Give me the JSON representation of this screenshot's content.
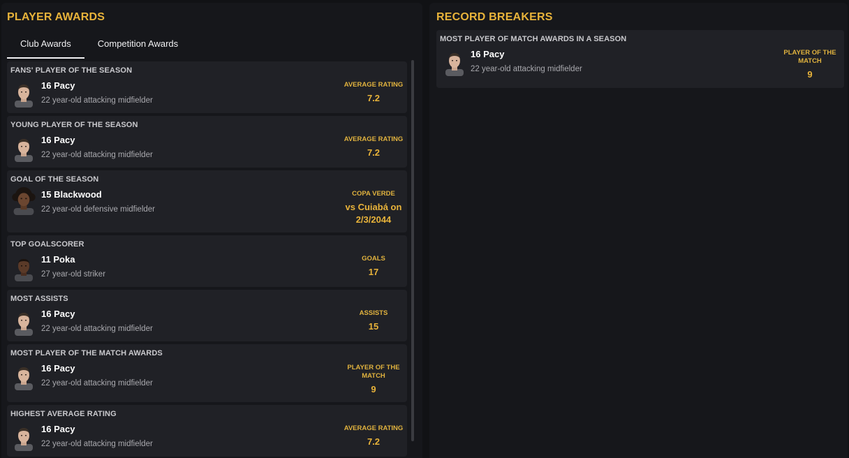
{
  "left_panel": {
    "title": "PLAYER AWARDS",
    "tabs": [
      {
        "label": "Club Awards",
        "active": true
      },
      {
        "label": "Competition Awards",
        "active": false
      }
    ],
    "awards": [
      {
        "title": "FANS' PLAYER OF THE SEASON",
        "player": "16 Pacy",
        "desc": "22 year-old attacking midfielder",
        "stat_label": "AVERAGE RATING",
        "stat_value": "7.2"
      },
      {
        "title": "YOUNG PLAYER OF THE SEASON",
        "player": "16 Pacy",
        "desc": "22 year-old attacking midfielder",
        "stat_label": "AVERAGE RATING",
        "stat_value": "7.2"
      },
      {
        "title": "GOAL OF THE SEASON",
        "player": "15 Blackwood",
        "desc": "22 year-old defensive midfielder",
        "stat_label": "COPA VERDE",
        "stat_value_line1": "vs Cuiabá on",
        "stat_value_line2": "2/3/2044"
      },
      {
        "title": "TOP GOALSCORER",
        "player": "11 Poka",
        "desc": "27 year-old striker",
        "stat_label": "GOALS",
        "stat_value": "17"
      },
      {
        "title": "MOST ASSISTS",
        "player": "16 Pacy",
        "desc": "22 year-old attacking midfielder",
        "stat_label": "ASSISTS",
        "stat_value": "15"
      },
      {
        "title": "MOST PLAYER OF THE MATCH AWARDS",
        "player": "16 Pacy",
        "desc": "22 year-old attacking midfielder",
        "stat_label_line1": "PLAYER OF THE",
        "stat_label_line2": "MATCH",
        "stat_value": "9"
      },
      {
        "title": "HIGHEST AVERAGE RATING",
        "player": "16 Pacy",
        "desc": "22 year-old attacking midfielder",
        "stat_label": "AVERAGE RATING",
        "stat_value": "7.2"
      }
    ]
  },
  "right_panel": {
    "title": "RECORD BREAKERS",
    "records": [
      {
        "title": "MOST PLAYER OF MATCH AWARDS IN A SEASON",
        "player": "16 Pacy",
        "desc": "22 year-old attacking midfielder",
        "stat_label_line1": "PLAYER OF THE",
        "stat_label_line2": "MATCH",
        "stat_value": "9"
      }
    ]
  },
  "colors": {
    "accent": "#e8b33a",
    "card_bg": "#202126",
    "panel_bg": "#16171b",
    "page_bg": "#111215"
  }
}
